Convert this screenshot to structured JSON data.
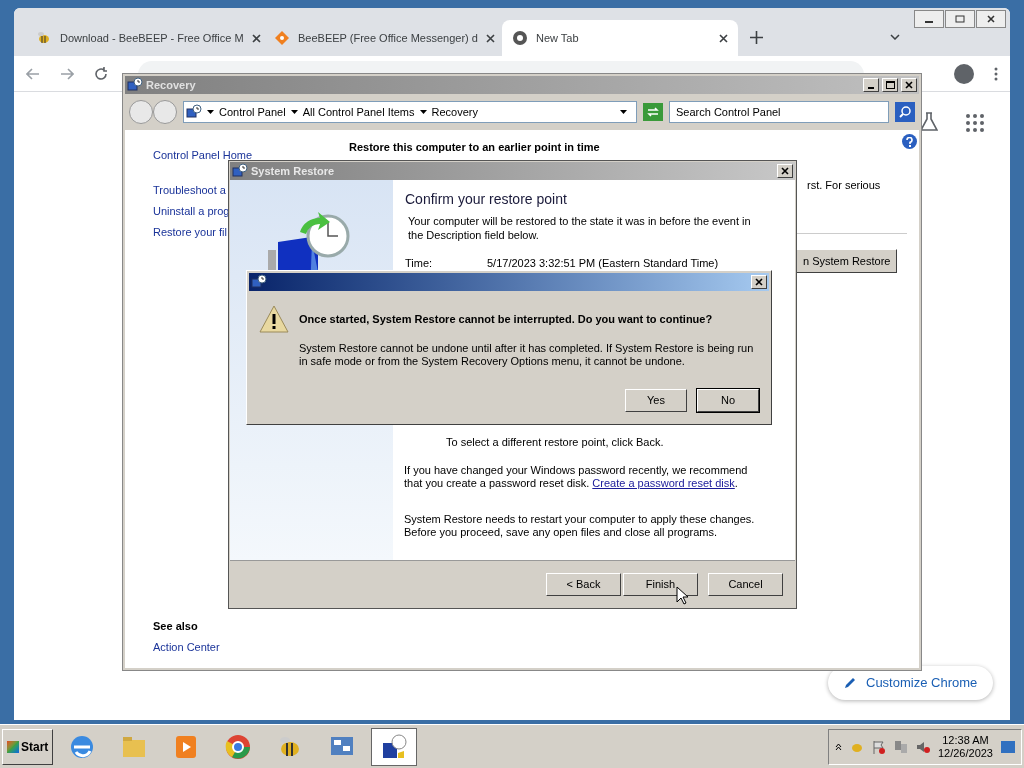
{
  "browser": {
    "tabs": [
      {
        "label": "Download - BeeBEEP - Free Office M",
        "selected": false
      },
      {
        "label": "BeeBEEP (Free Office Messenger) d",
        "selected": false
      },
      {
        "label": "New Tab",
        "selected": true
      }
    ],
    "customize_button": "Customize Chrome"
  },
  "recovery_window": {
    "title": "Recovery",
    "breadcrumbs": [
      "Control Panel",
      "All Control Panel Items",
      "Recovery"
    ],
    "search": {
      "placeholder": "Search Control Panel"
    },
    "nav_links": [
      "Control Panel Home",
      "Troubleshoot a",
      "Uninstall a prog",
      "Restore your fil"
    ],
    "see_also_heading": "See also",
    "see_also_links": [
      "Action Center"
    ],
    "main_heading": "Restore this computer to an earlier point in time",
    "main_text": "rst. For serious",
    "open_button": "n System Restore"
  },
  "system_restore": {
    "title": "System Restore",
    "heading": "Confirm your restore point",
    "intro": "Your computer will be restored to the state it was in before the event in the Description field below.",
    "time_label": "Time:",
    "time_value": "5/17/2023 3:32:51 PM (Eastern Standard Time)",
    "back_hint": "To select a different restore point, click Back.",
    "password_text": "If you have changed your Windows password recently, we recommend that you create a password reset disk.",
    "password_link": "Create a password reset disk",
    "password_end": ".",
    "restart_text": "System Restore needs to restart your computer to apply these changes. Before you proceed, save any open files and close all programs.",
    "buttons": [
      "< Back",
      "Finish",
      "Cancel"
    ]
  },
  "message_box": {
    "heading": "Once started, System Restore cannot be interrupted. Do you want to continue?",
    "body": "System Restore cannot be undone until after it has completed. If System Restore is being run in safe mode or from the System Recovery Options menu, it cannot be undone.",
    "buttons": [
      {
        "label": "Yes",
        "selected": false
      },
      {
        "label": "No",
        "selected": true
      }
    ]
  },
  "taskbar": {
    "start": "Start",
    "time": "12:38 AM",
    "date": "12/26/2023"
  }
}
